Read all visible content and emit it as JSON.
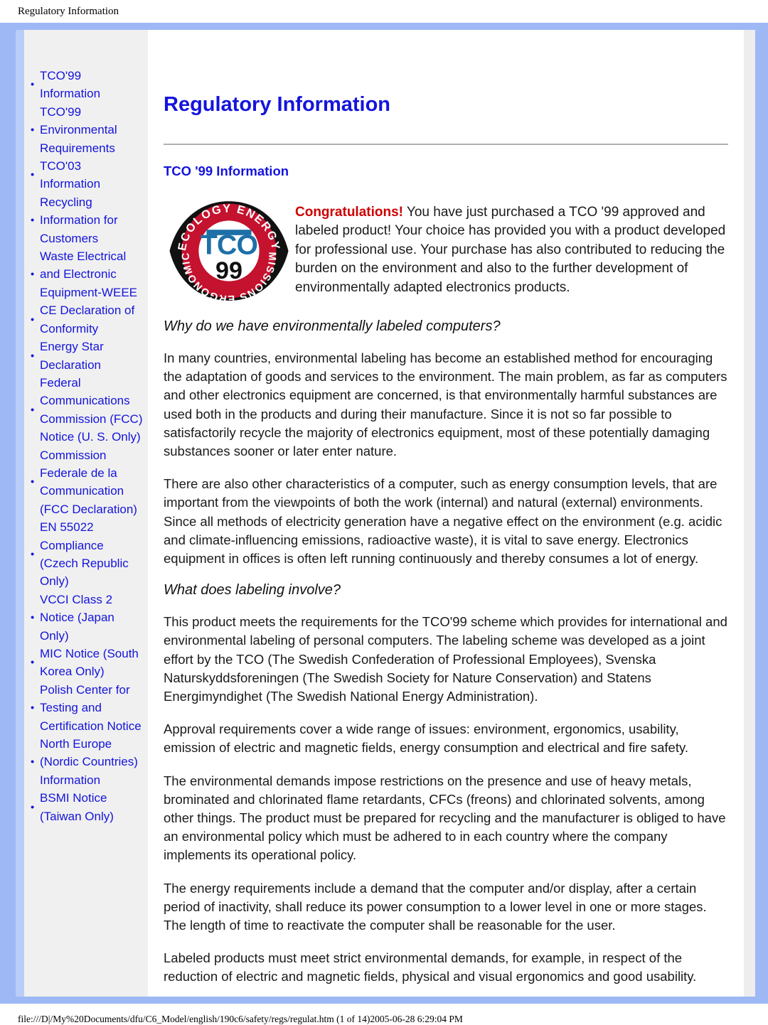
{
  "print_header": {
    "title": "Regulatory Information"
  },
  "sidebar": {
    "items": [
      {
        "label": "TCO'99 Information"
      },
      {
        "label": "TCO'99 Environmental Requirements"
      },
      {
        "label": "TCO'03 Information"
      },
      {
        "label": "Recycling Information for Customers"
      },
      {
        "label": "Waste Electrical and Electronic Equipment-WEEE"
      },
      {
        "label": "CE Declaration of Conformity"
      },
      {
        "label": "Energy Star Declaration"
      },
      {
        "label": "Federal Communications Commission (FCC) Notice (U. S. Only)"
      },
      {
        "label": "Commission Federale de la Communication (FCC Declaration)"
      },
      {
        "label": "EN 55022 Compliance (Czech Republic Only)"
      },
      {
        "label": "VCCI Class 2 Notice (Japan Only)"
      },
      {
        "label": "MIC Notice (South Korea Only)"
      },
      {
        "label": "Polish Center for Testing and Certification Notice"
      },
      {
        "label": "North Europe (Nordic Countries) Information"
      },
      {
        "label": "BSMI Notice (Taiwan Only)"
      }
    ]
  },
  "main": {
    "page_title": "Regulatory Information",
    "section_title": "TCO '99 Information",
    "logo": {
      "name": "tco-99-certification-logo",
      "top_arc_text": "ECOLOGY ENERGY",
      "bottom_arc_text": "EMISSIONS ERGONOMICS",
      "center_mark": "TCO",
      "center_year": "99",
      "ring_color": "#c4122f",
      "mark_color": "#1e6fa8",
      "year_color": "#111111"
    },
    "intro": {
      "lead": "Congratulations!",
      "body": " You have just purchased a TCO '99 approved and labeled product! Your choice has provided you with a product developed for professional use. Your purchase has also contributed to reducing the burden on the environment and also to the further development of environmentally adapted electronics products."
    },
    "heading_why": "Why do we have environmentally labeled computers?",
    "para_1": "In many countries, environmental labeling has become an established method for encouraging the adaptation of goods and services to the environment. The main problem, as far as computers and other electronics equipment are concerned, is that environmentally harmful substances are used both in the products and during their manufacture. Since it is not so far possible to satisfactorily recycle the majority of electronics equipment, most of these potentially damaging substances sooner or later enter nature.",
    "para_2": "There are also other characteristics of a computer, such as energy consumption levels, that are important from the viewpoints of both the work (internal) and natural (external) environments. Since all methods of electricity generation have a negative effect on the environment (e.g. acidic and climate-influencing emissions, radioactive waste), it is vital to save energy. Electronics equipment in offices is often left running continuously and thereby consumes a lot of energy.",
    "heading_labeling": "What does labeling involve?",
    "para_3": "This product meets the requirements for the TCO'99 scheme which provides for international and environmental labeling of personal computers. The labeling scheme was developed as a joint effort by the TCO (The Swedish Confederation of Professional Employees), Svenska Naturskyddsforeningen (The Swedish Society for Nature Conservation) and Statens Energimyndighet (The Swedish National Energy Administration).",
    "para_4": "Approval requirements cover a wide range of issues: environment, ergonomics, usability, emission of electric and magnetic fields, energy consumption and electrical and fire safety.",
    "para_5": "The environmental demands impose restrictions on the presence and use of heavy metals, brominated and chlorinated flame retardants, CFCs (freons) and chlorinated solvents, among other things. The product must be prepared for recycling and the manufacturer is obliged to have an environmental policy which must be adhered to in each country where the company implements its operational policy.",
    "para_6": "The energy requirements include a demand that the computer and/or display, after a certain period of inactivity, shall reduce its power consumption to a lower level in one or more stages. The length of time to reactivate the computer shall be reasonable for the user.",
    "para_7": "Labeled products must meet strict environmental demands, for example, in respect of the reduction of electric and magnetic fields, physical and visual ergonomics and good usability."
  },
  "footer": {
    "path": "file:///D|/My%20Documents/dfu/C6_Model/english/190c6/safety/regs/regulat.htm (1 of 14)2005-06-28 6:29:04 PM"
  },
  "colors": {
    "frame_blue": "#9db8f5",
    "frame_accent": "#b9cdf8",
    "sidebar_bg": "#f0f0f0",
    "link_blue": "#1414dc",
    "accent_red": "#cc0000"
  }
}
